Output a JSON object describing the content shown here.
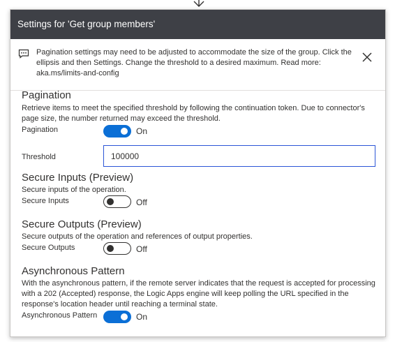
{
  "header": {
    "title": "Settings for 'Get group members'"
  },
  "notice": {
    "text": "Pagination settings may need to be adjusted to accommodate the size of the group. Click the ellipsis and then Settings. Change the threshold to a desired maximum. Read more: aka.ms/limits-and-config"
  },
  "pagination": {
    "title": "Pagination",
    "description": "Retrieve items to meet the specified threshold by following the continuation token. Due to connector's page size, the number returned may exceed the threshold.",
    "toggle_label": "Pagination",
    "state": "On",
    "threshold_label": "Threshold",
    "threshold_value": "100000"
  },
  "secure_inputs": {
    "title": "Secure Inputs (Preview)",
    "description": "Secure inputs of the operation.",
    "toggle_label": "Secure Inputs",
    "state": "Off"
  },
  "secure_outputs": {
    "title": "Secure Outputs (Preview)",
    "description": "Secure outputs of the operation and references of output properties.",
    "toggle_label": "Secure Outputs",
    "state": "Off"
  },
  "async": {
    "title": "Asynchronous Pattern",
    "description": "With the asynchronous pattern, if the remote server indicates that the request is accepted for processing with a 202 (Accepted) response, the Logic Apps engine will keep polling the URL specified in the response's location header until reaching a terminal state.",
    "toggle_label": "Asynchronous Pattern",
    "state": "On"
  },
  "colors": {
    "header_bg": "#3e4046",
    "toggle_on": "#0b6fd6",
    "input_border": "#2b55d6"
  },
  "icons": [
    "connector-arrow-icon",
    "message-icon",
    "close-icon"
  ]
}
